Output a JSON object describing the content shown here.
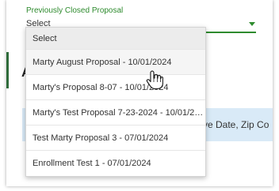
{
  "field": {
    "label": "Previously Closed Proposal",
    "value": "Select"
  },
  "background": {
    "heading_fragment": "A",
    "band_text": "ve Date, Zip Co"
  },
  "dropdown": {
    "options": [
      {
        "label": "Select"
      },
      {
        "label": "Marty August Proposal - 10/01/2024"
      },
      {
        "label": "Marty's Proposal 8-07 - 10/01/2024"
      },
      {
        "label": "Marty's Test Proposal 7-23-2024 - 10/01/20..."
      },
      {
        "label": "Test Marty Proposal 3 - 07/01/2024"
      },
      {
        "label": "Enrollment Test 1 - 07/01/2024"
      }
    ],
    "hovered_index": 1
  },
  "colors": {
    "accent": "#2e8b2e",
    "band": "#d9eaf7"
  },
  "icons": {
    "caret": "chevron-down-icon",
    "cursor": "hand-pointer-icon"
  }
}
